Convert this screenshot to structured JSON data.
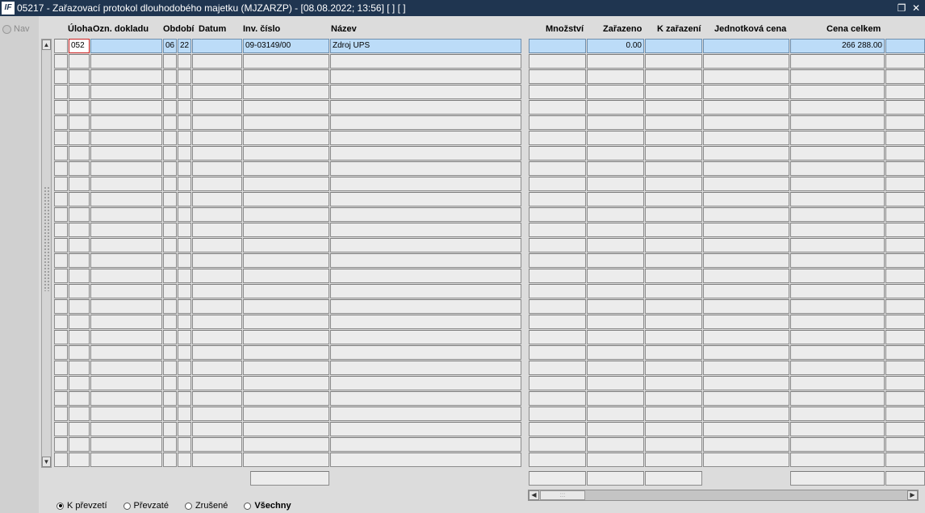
{
  "window": {
    "logo": "IF",
    "title": "05217 - Zařazovací protokol dlouhodobého majetku (MJZARZP) - [08.08.2022; 13:56]  [ ]  [ ]",
    "restore_icon": "❐",
    "close_icon": "✕"
  },
  "nav": {
    "label": "Nav"
  },
  "columns": {
    "uloha": "Úloha",
    "ozn_dokladu": "Ozn. dokladu",
    "obdobi": "Období",
    "datum": "Datum",
    "inv_cislo": "Inv. číslo",
    "nazev": "Název",
    "mnozstvi": "Množství",
    "zarazeno": "Zařazeno",
    "k_zarazeni": "K zařazení",
    "jednotkova_cena": "Jednotková cena",
    "cena_celkem": "Cena celkem"
  },
  "rows": [
    {
      "uloha": "052",
      "ozn_dokladu": "",
      "obdobi_mesic": "06",
      "obdobi_rok": "22",
      "datum": "",
      "inv_cislo": "09-03149/00",
      "nazev": "Zdroj UPS",
      "mnozstvi": "",
      "zarazeno": "0.00",
      "k_zarazeni": "",
      "jednotkova_cena": "",
      "cena_celkem": "266 288.00"
    }
  ],
  "empty_row_count": 27,
  "filter": {
    "options": [
      {
        "label": "K převzetí",
        "selected": true
      },
      {
        "label": "Převzaté",
        "selected": false
      },
      {
        "label": "Zrušené",
        "selected": false
      },
      {
        "label": "Všechny",
        "selected": false
      }
    ]
  },
  "colors": {
    "titlebar": "#1f3550",
    "selected_row": "#bcdcf8",
    "focus_border": "#cc2222"
  }
}
